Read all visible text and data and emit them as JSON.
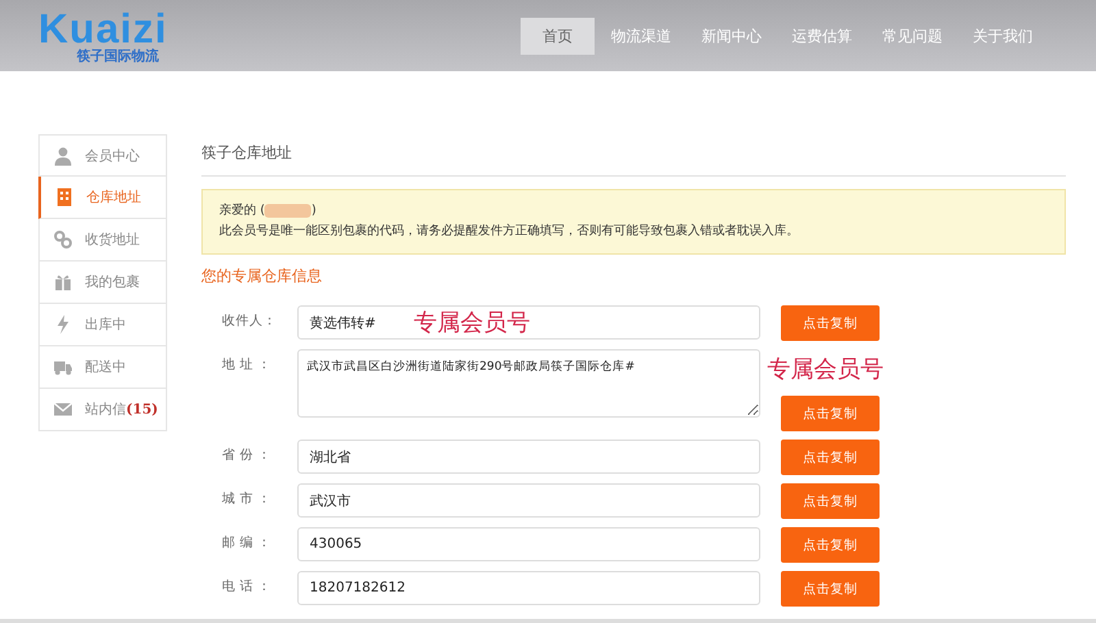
{
  "header": {
    "logo": {
      "text": "Kuaizi",
      "subtitle": "筷子国际物流"
    },
    "nav": [
      {
        "label": "首页",
        "selected": true
      },
      {
        "label": "物流渠道",
        "selected": false
      },
      {
        "label": "新闻中心",
        "selected": false
      },
      {
        "label": "运费估算",
        "selected": false
      },
      {
        "label": "常见问题",
        "selected": false
      },
      {
        "label": "关于我们",
        "selected": false
      }
    ]
  },
  "sidebar": {
    "items": [
      {
        "kind": "user",
        "label": "会员中心",
        "selected": false
      },
      {
        "kind": "building",
        "label": "仓库地址",
        "selected": true
      },
      {
        "kind": "link",
        "label": "收货地址",
        "selected": false
      },
      {
        "kind": "gift",
        "label": "我的包裹",
        "selected": false
      },
      {
        "kind": "bolt",
        "label": "出库中",
        "selected": false
      },
      {
        "kind": "truck",
        "label": "配送中",
        "selected": false
      },
      {
        "kind": "mail",
        "label": "站内信",
        "count": "(15)",
        "selected": false
      }
    ]
  },
  "content": {
    "title": "筷子仓库地址",
    "notice": {
      "greeting_start": "亲爱的 (",
      "greeting_end": ")",
      "message": "此会员号是唯一能区别包裹的代码，请务必提醒发件方正确填写，否则有可能导致包裹入错或者耽误入库。"
    },
    "section_title": "您的专属仓库信息",
    "fields": [
      {
        "kind": "input",
        "label": "收件人：",
        "value": "黄选伟转#",
        "button": "点击复制",
        "annotation": "专属会员号"
      },
      {
        "kind": "textarea",
        "label": "地 址 ：",
        "value": "武汉市武昌区白沙洲街道陆家街290号邮政局筷子国际仓库#",
        "button": "点击复制",
        "annotation": "专属会员号"
      },
      {
        "kind": "input",
        "label": "省 份 ：",
        "value": "湖北省",
        "button": "点击复制"
      },
      {
        "kind": "input",
        "label": "城 市 ：",
        "value": "武汉市",
        "button": "点击复制"
      },
      {
        "kind": "input",
        "label": "邮 编 ：",
        "value": "430065",
        "button": "点击复制"
      },
      {
        "kind": "input",
        "label": "电 话 ：",
        "value": "18207182612",
        "button": "点击复制"
      }
    ]
  }
}
